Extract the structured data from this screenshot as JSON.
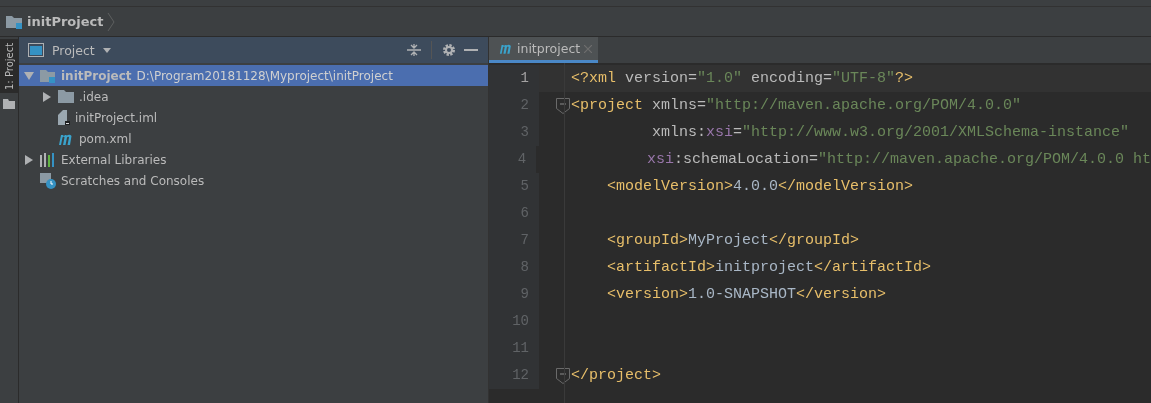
{
  "breadcrumb": {
    "label": "initProject"
  },
  "side_tab": {
    "label": "1: Project",
    "selected": true
  },
  "project_panel": {
    "title": "Project"
  },
  "tree": [
    {
      "label": "initProject",
      "detail": "D:\\Program20181128\\Myproject\\initProject",
      "kind": "module",
      "expanded": true,
      "selected": true,
      "children": [
        {
          "label": ".idea",
          "kind": "folder",
          "expanded": false,
          "selected": false
        },
        {
          "label": "initProject.iml",
          "kind": "iml",
          "selected": false
        },
        {
          "label": "pom.xml",
          "kind": "maven",
          "selected": false
        }
      ]
    },
    {
      "label": "External Libraries",
      "kind": "libraries",
      "expanded": false,
      "selected": false
    },
    {
      "label": "Scratches and Consoles",
      "kind": "scratches",
      "selected": false
    }
  ],
  "editor_tabs": [
    {
      "label": "initproject",
      "selected": true
    }
  ],
  "code_lines": [
    {
      "number": "1",
      "current": true,
      "fold": false,
      "tokens": [
        {
          "kind": "tag",
          "text": "<?xml "
        },
        {
          "kind": "attr",
          "text": "version="
        },
        {
          "kind": "string",
          "text": "\"1.0\""
        },
        {
          "kind": "attr",
          "text": " encoding="
        },
        {
          "kind": "string",
          "text": "\"UTF-8\""
        },
        {
          "kind": "tag",
          "text": "?>"
        }
      ]
    },
    {
      "number": "2",
      "current": false,
      "fold": true,
      "tokens": [
        {
          "kind": "tag",
          "text": "<project "
        },
        {
          "kind": "attr",
          "text": "xmlns="
        },
        {
          "kind": "string",
          "text": "\"http://maven.apache.org/POM/4.0.0\""
        }
      ]
    },
    {
      "number": "3",
      "current": false,
      "fold": false,
      "tokens": [
        {
          "kind": "attr",
          "text": "         xmlns:"
        },
        {
          "kind": "ns",
          "text": "xsi"
        },
        {
          "kind": "attr",
          "text": "="
        },
        {
          "kind": "string",
          "text": "\"http://www.w3.org/2001/XMLSchema-instance\""
        }
      ]
    },
    {
      "number": "4",
      "current": false,
      "fold": false,
      "tokens": [
        {
          "kind": "ns",
          "text": "         xsi"
        },
        {
          "kind": "attr",
          "text": ":schemaLocation="
        },
        {
          "kind": "string",
          "text": "\"http://maven.apache.org/POM/4.0.0 ht"
        }
      ]
    },
    {
      "number": "5",
      "current": false,
      "fold": false,
      "tokens": [
        {
          "kind": "tag",
          "text": "    <modelVersion>"
        },
        {
          "kind": "text",
          "text": "4.0.0"
        },
        {
          "kind": "tag",
          "text": "</modelVersion>"
        }
      ]
    },
    {
      "number": "6",
      "current": false,
      "fold": false
    },
    {
      "number": "7",
      "current": false,
      "fold": false,
      "tokens": [
        {
          "kind": "tag",
          "text": "    <groupId>"
        },
        {
          "kind": "text",
          "text": "MyProject"
        },
        {
          "kind": "tag",
          "text": "</groupId>"
        }
      ]
    },
    {
      "number": "8",
      "current": false,
      "fold": false,
      "tokens": [
        {
          "kind": "tag",
          "text": "    <artifactId>"
        },
        {
          "kind": "text",
          "text": "initproject"
        },
        {
          "kind": "tag",
          "text": "</artifactId>"
        }
      ]
    },
    {
      "number": "9",
      "current": false,
      "fold": false,
      "tokens": [
        {
          "kind": "tag",
          "text": "    <version>"
        },
        {
          "kind": "text",
          "text": "1.0-SNAPSHOT"
        },
        {
          "kind": "tag",
          "text": "</version>"
        }
      ]
    },
    {
      "number": "10",
      "current": false,
      "fold": false
    },
    {
      "number": "11",
      "current": false,
      "fold": false
    },
    {
      "number": "12",
      "current": false,
      "fold": true,
      "tokens": [
        {
          "kind": "tag",
          "text": "</project>"
        }
      ]
    }
  ]
}
